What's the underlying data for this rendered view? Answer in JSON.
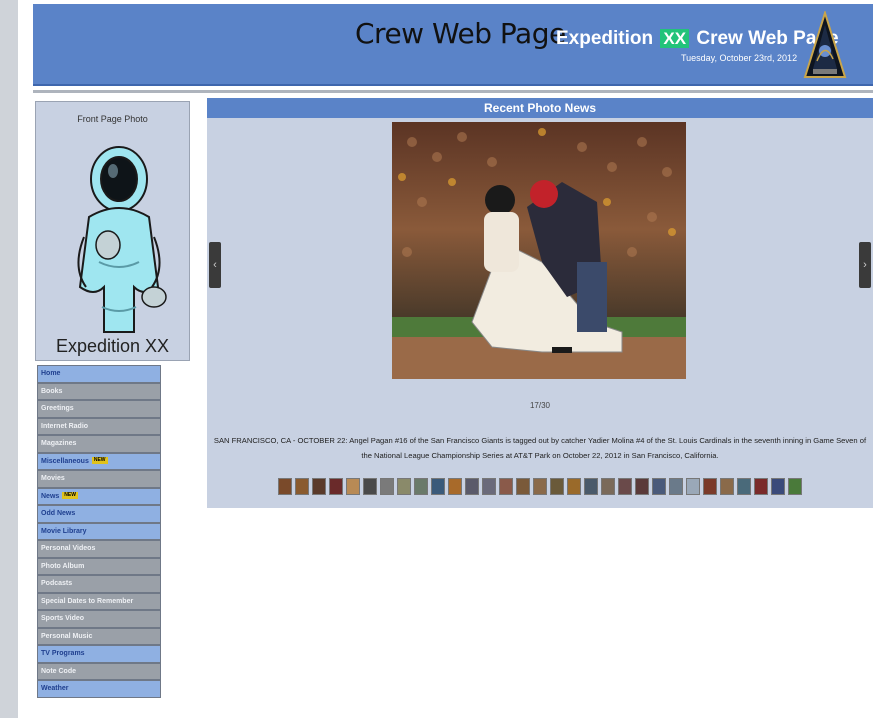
{
  "header": {
    "title": "Crew Web Page",
    "brand_prefix": "Expedition",
    "brand_badge": "XX",
    "brand_suffix": "Crew Web Page",
    "date": "Tuesday, October 23rd, 2012"
  },
  "front_photo": {
    "label": "Front Page Photo",
    "caption": "Expedition XX"
  },
  "nav": [
    {
      "label": "Home",
      "style": "blue"
    },
    {
      "label": "Books",
      "style": "gray"
    },
    {
      "label": "Greetings",
      "style": "gray"
    },
    {
      "label": "Internet Radio",
      "style": "gray"
    },
    {
      "label": "Magazines",
      "style": "gray"
    },
    {
      "label": "Miscellaneous",
      "style": "blue",
      "new": "NEW"
    },
    {
      "label": "Movies",
      "style": "gray"
    },
    {
      "label": "News",
      "style": "blue",
      "new": "NEW"
    },
    {
      "label": "Odd News",
      "style": "blue"
    },
    {
      "label": "Movie Library",
      "style": "blue"
    },
    {
      "label": "Personal Videos",
      "style": "gray"
    },
    {
      "label": "Photo Album",
      "style": "gray"
    },
    {
      "label": "Podcasts",
      "style": "gray"
    },
    {
      "label": "Special Dates to Remember",
      "style": "gray"
    },
    {
      "label": "Sports Video",
      "style": "gray"
    },
    {
      "label": "Personal Music",
      "style": "gray"
    },
    {
      "label": "TV Programs",
      "style": "blue"
    },
    {
      "label": "Note Code",
      "style": "gray"
    },
    {
      "label": "Weather",
      "style": "blue"
    }
  ],
  "news": {
    "title": "Recent Photo News",
    "counter": "17/30",
    "caption": "SAN FRANCISCO, CA - OCTOBER 22: Angel Pagan #16 of the San Francisco Giants is tagged out by catcher Yadier Molina #4 of the St. Louis Cardinals in the seventh inning in Game Seven of the National League Championship Series at AT&T Park on October 22, 2012 in San Francisco, California.",
    "prev_icon": "chevron-left-icon",
    "next_icon": "chevron-right-icon",
    "thumbnail_colors": [
      "#7a4a2a",
      "#8a5b2f",
      "#5a3a2a",
      "#6a2a2a",
      "#b88a55",
      "#4a4a4a",
      "#7a7a7a",
      "#8a8a6a",
      "#6a7a6a",
      "#3a5a7a",
      "#a86a2a",
      "#5a5a6a",
      "#6a6a7a",
      "#8a5a4a",
      "#7a5a3a",
      "#8a6a4a",
      "#6a5a3a",
      "#9a6a2a",
      "#4a5a6a",
      "#7a6a5a",
      "#6a4a4a",
      "#5a3a3a",
      "#4a5a7a",
      "#6a7a8a",
      "#9aa8b8",
      "#7a3a2a",
      "#8a6a4a",
      "#4a6a7a",
      "#7a2a2a",
      "#3a4a7a",
      "#4a7a3a"
    ]
  },
  "colors": {
    "header_bg": "#5a83c8",
    "panel_bg": "#c8d1e2",
    "badge": "#22c37a",
    "nav_blue": "#8fb0e2",
    "nav_gray": "#9aa0a8"
  }
}
